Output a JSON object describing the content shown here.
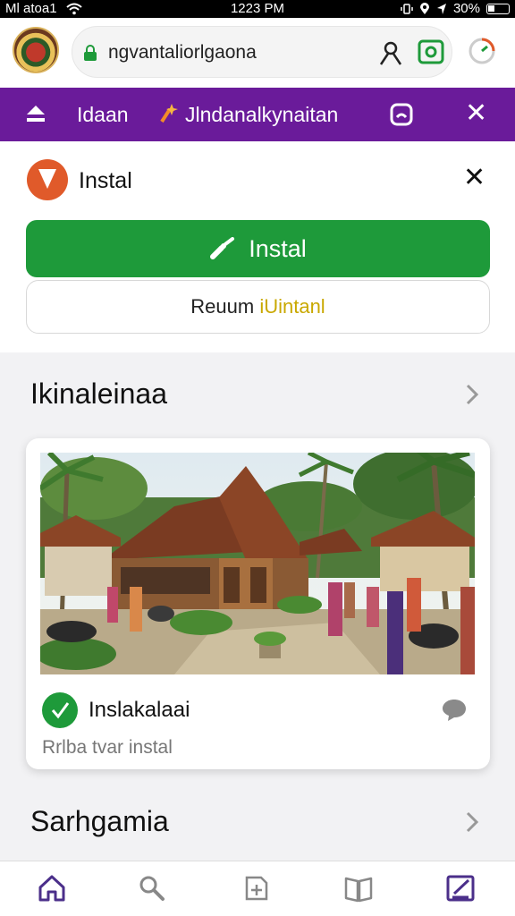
{
  "status": {
    "carrier": "Ml atoa1",
    "time": "1223 PM",
    "battery": "30%"
  },
  "address": {
    "url": "ngvantaliorlgaona"
  },
  "toolbar": {
    "left_label": "Idaan",
    "right_label": "Jlndanalkynaitan"
  },
  "install": {
    "title": "Instal",
    "primary_label": "Instal",
    "secondary_prefix": "Reuum ",
    "secondary_highlight": "iUintanl",
    "accent": "#1e9a3a"
  },
  "section1": {
    "title": "Ikinaleinaa"
  },
  "card": {
    "title": "Inslakalaai",
    "subtitle": "Rrlba tvar instal"
  },
  "section2": {
    "title": "Sarhgamia"
  },
  "nav": {
    "items": [
      "home-icon",
      "search-icon",
      "add-icon",
      "book-icon",
      "edit-icon"
    ]
  },
  "colors": {
    "brand_purple": "#6a1b9a",
    "green": "#1e9a3a"
  }
}
